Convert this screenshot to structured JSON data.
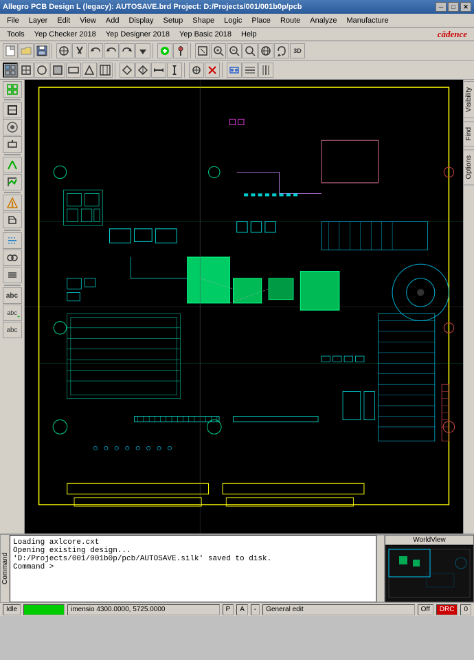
{
  "title": {
    "text": "Allegro PCB Design L (legacy): AUTOSAVE.brd  Project: D:/Projects/001/001b0p/pcb",
    "minimize": "─",
    "maximize": "□",
    "close": "✕"
  },
  "menubar1": {
    "items": [
      "File",
      "Layer",
      "Edit",
      "View",
      "Add",
      "Display",
      "Setup",
      "Shape",
      "Logic",
      "Place",
      "Route",
      "Analyze",
      "Manufacture"
    ]
  },
  "menubar2": {
    "items": [
      "Tools",
      "Yep Checker 2018",
      "Yep Designer 2018",
      "Yep Basic 2018",
      "Help"
    ],
    "logo": "cādence"
  },
  "toolbar1": {
    "buttons": [
      "📂",
      "💾",
      "✂",
      "🔙",
      "⟳",
      "⟲",
      "⬇",
      "🔴",
      "📌",
      "▦",
      "⬛",
      "🔍",
      "🔍",
      "🔍",
      "🔍",
      "🔍",
      "🔍",
      "⊕",
      "3D"
    ]
  },
  "toolbar2": {
    "buttons": [
      "▦",
      "⊞",
      "○",
      "⊟",
      "▭",
      "⬡",
      "▦",
      "▶",
      "◀",
      "▲",
      "▼",
      "⊕",
      "✕",
      "🔌",
      "↔",
      "↕"
    ]
  },
  "right_tabs": [
    "Visibility",
    "Find",
    "Options"
  ],
  "console": {
    "label": "Command",
    "lines": [
      "Loading axlcore.cxt",
      "Opening existing design...",
      "'D:/Projects/001/001b0p/pcb/AUTOSAVE.silk' saved to disk.",
      "Command >"
    ]
  },
  "worldview": {
    "label": "WorldView"
  },
  "statusbar": {
    "idle": "Idle",
    "progress": "",
    "coordinates": "imensio  4300.0000, 5725.0000",
    "mode1": "P",
    "mode2": "A",
    "separator": "-",
    "edit_mode": "General edit",
    "off_label": "Off",
    "drc": "DRC",
    "number": "0"
  }
}
